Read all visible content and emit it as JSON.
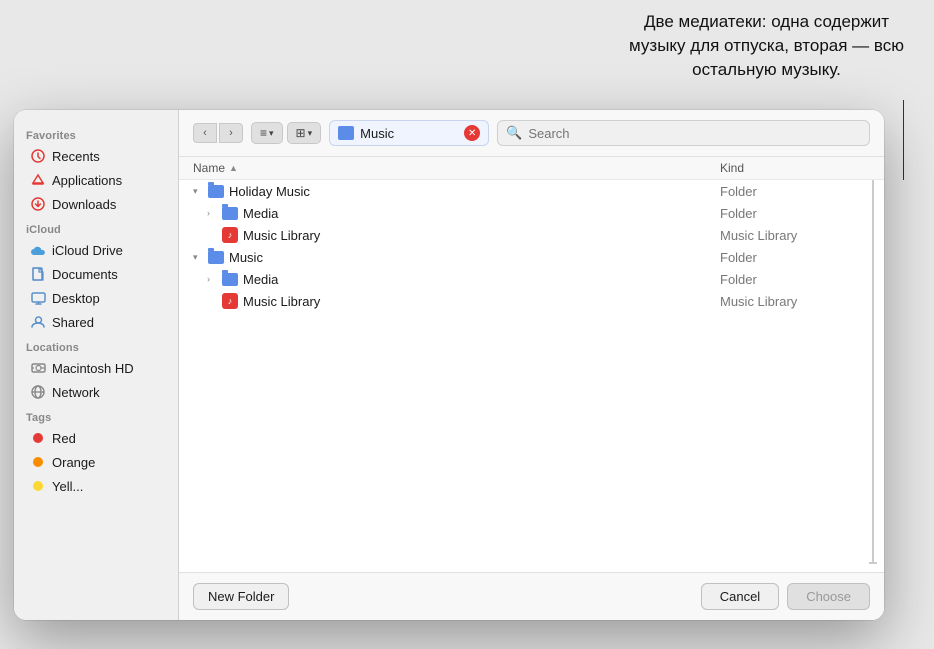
{
  "annotation": {
    "line1": "Две медиатеки: одна содержит",
    "line2": "музыку для отпуска, вторая — всю",
    "line3": "остальную музыку."
  },
  "sidebar": {
    "favorites_label": "Favorites",
    "icloud_label": "iCloud",
    "locations_label": "Locations",
    "tags_label": "Tags",
    "items": {
      "recents": "Recents",
      "applications": "Applications",
      "downloads": "Downloads",
      "icloud_drive": "iCloud Drive",
      "documents": "Documents",
      "desktop": "Desktop",
      "shared": "Shared",
      "macintosh": "Macintosh HD",
      "network": "Network",
      "tag_red": "Red",
      "tag_orange": "Orange",
      "tag_yellow": "Yell..."
    }
  },
  "toolbar": {
    "location_text": "Music",
    "search_placeholder": "Search"
  },
  "file_list": {
    "col_name": "Name",
    "col_kind": "Kind",
    "rows": [
      {
        "indent": 0,
        "expanded": true,
        "name": "Holiday Music",
        "kind": "Folder",
        "type": "folder"
      },
      {
        "indent": 1,
        "expanded": false,
        "name": "Media",
        "kind": "Folder",
        "type": "folder"
      },
      {
        "indent": 1,
        "expanded": false,
        "name": "Music Library",
        "kind": "Music Library",
        "type": "musiclib"
      },
      {
        "indent": 0,
        "expanded": true,
        "name": "Music",
        "kind": "Folder",
        "type": "folder"
      },
      {
        "indent": 1,
        "expanded": false,
        "name": "Media",
        "kind": "Folder",
        "type": "folder"
      },
      {
        "indent": 1,
        "expanded": false,
        "name": "Music Library",
        "kind": "Music Library",
        "type": "musiclib"
      }
    ]
  },
  "bottom_bar": {
    "new_folder": "New Folder",
    "cancel": "Cancel",
    "choose": "Choose"
  },
  "tags": [
    {
      "name": "Red",
      "color": "#e53935"
    },
    {
      "name": "Orange",
      "color": "#fb8c00"
    },
    {
      "name": "Yellow",
      "color": "#fdd835"
    }
  ]
}
